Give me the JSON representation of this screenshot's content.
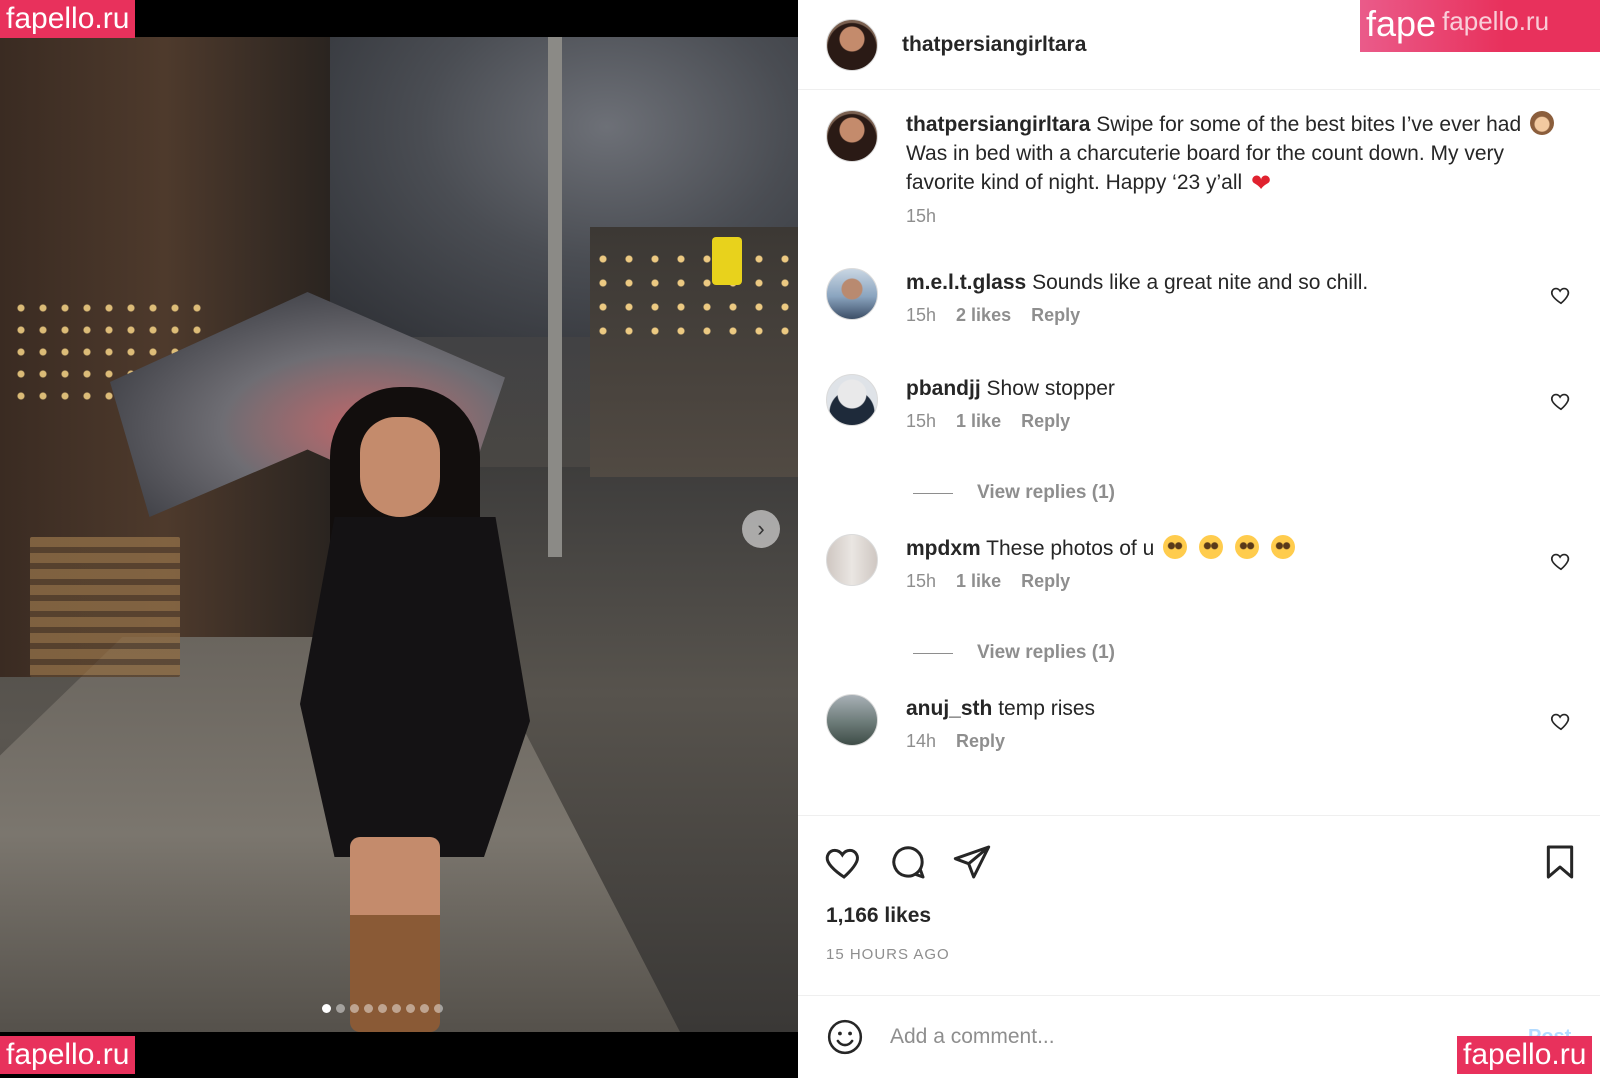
{
  "post": {
    "author": "thatpersiangirltara",
    "caption_user": "thatpersiangirltara",
    "caption_part1": "Swipe for some of the best bites I’ve ever had",
    "caption_part2": "Was in bed with a charcuterie board for the count down. My very favorite kind of night. Happy ‘23 y’all",
    "caption_time": "15h",
    "carousel": {
      "total": 9,
      "active_index": 0
    }
  },
  "comments": [
    {
      "user": "m.e.l.t.glass",
      "text": "Sounds like a great nite and so chill.",
      "time": "15h",
      "likes": "2 likes",
      "reply": "Reply"
    },
    {
      "user": "pbandjj",
      "text": "Show stopper",
      "time": "15h",
      "likes": "1 like",
      "reply": "Reply",
      "view_replies": "View replies (1)"
    },
    {
      "user": "mpdxm",
      "text": "These photos of u",
      "time": "15h",
      "likes": "1 like",
      "reply": "Reply",
      "view_replies": "View replies (1)"
    },
    {
      "user": "anuj_sth",
      "text": "temp rises",
      "time": "14h",
      "reply": "Reply"
    }
  ],
  "stats": {
    "likes": "1,166 likes",
    "time_ago": "15 HOURS AGO"
  },
  "comment_box": {
    "placeholder": "Add a comment...",
    "post_label": "Post"
  },
  "watermarks": {
    "label": "fapello.ru",
    "partial": "fape"
  },
  "icons": {
    "like": "heart-icon",
    "comment": "comment-icon",
    "share": "share-icon",
    "save": "bookmark-icon",
    "emoji": "smiley-icon",
    "next": "chevron-right-icon"
  },
  "colors": {
    "accent_red": "#e0222f",
    "watermark_pink": "#e8315c",
    "muted_text": "#8e8e8e",
    "post_button": "#b3dbff"
  }
}
